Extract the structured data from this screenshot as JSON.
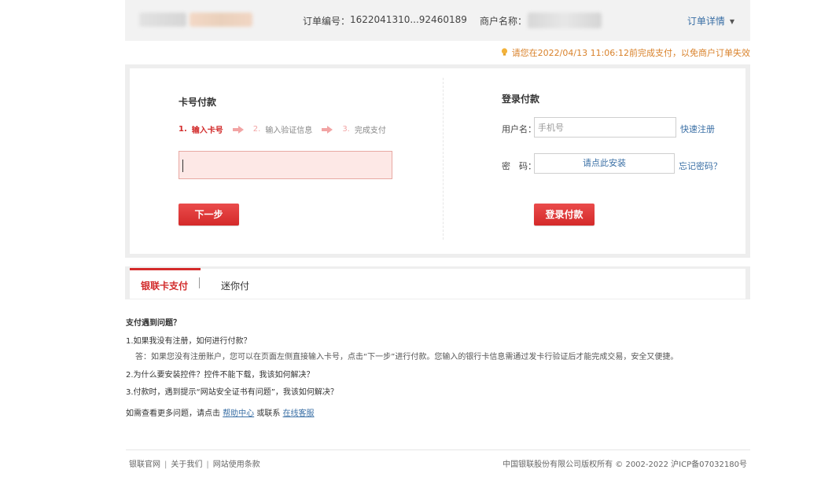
{
  "header": {
    "order_label": "订单编号：",
    "order_number": "1622041310...92460189",
    "merchant_label": "商户名称：",
    "detail_label": "订单详情"
  },
  "notice": {
    "deadline_text": "请您在2022/04/13 11:06:12前完成支付，以免商户订单失效"
  },
  "card_pay": {
    "title": "卡号付款",
    "steps": [
      {
        "num": "1.",
        "label": "输入卡号"
      },
      {
        "num": "2.",
        "label": "输入验证信息"
      },
      {
        "num": "3.",
        "label": "完成支付"
      }
    ],
    "card_value": "",
    "next_button": "下一步"
  },
  "login_pay": {
    "title": "登录付款",
    "username_label": "用户名：",
    "username_placeholder": "手机号",
    "quick_register": "快速注册",
    "password_label": "密　码：",
    "install_prompt": "请点此安装",
    "forgot_password": "忘记密码？",
    "login_button": "登录付款"
  },
  "tabs": [
    {
      "label": "银联卡支付",
      "active": true
    },
    {
      "label": "迷你付",
      "active": false
    }
  ],
  "faq": {
    "title": "支付遇到问题？",
    "q1": "1.如果我没有注册，如何进行付款？",
    "a1": "答：如果您没有注册账户，您可以在页面左侧直接输入卡号，点击“下一步”进行付款。您输入的银行卡信息需通过发卡行验证后才能完成交易，安全又便捷。",
    "q2": "2.为什么要安装控件？控件不能下载，我该如何解决？",
    "q3": "3.付款时，遇到提示“网站安全证书有问题”，我该如何解决？",
    "more_prefix": "如需查看更多问题，请点击",
    "help_center": "帮助中心",
    "or_contact": "或联系",
    "online_service": "在线客服"
  },
  "footer": {
    "links": [
      "银联官网",
      "关于我们",
      "网站使用条款"
    ],
    "copyright": "中国银联股份有限公司版权所有 © 2002-2022  沪ICP备07032180号"
  },
  "colors": {
    "accent_red": "#d42a2a",
    "link_blue": "#3a6fa5",
    "warning_orange": "#d9822b"
  }
}
